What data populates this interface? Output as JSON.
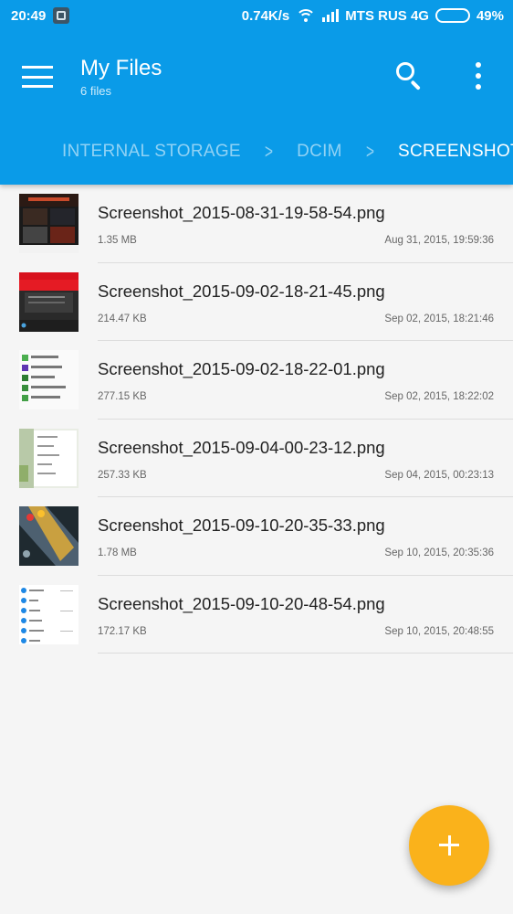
{
  "status_bar": {
    "time": "20:49",
    "speed": "0.74K/s",
    "carrier": "MTS RUS 4G",
    "battery": "49%",
    "battery_level": 0.49
  },
  "toolbar": {
    "title": "My Files",
    "subtitle": "6 files"
  },
  "breadcrumb": [
    "INTERNAL STORAGE",
    "DCIM",
    "SCREENSHOTS"
  ],
  "files": [
    {
      "name": "Screenshot_2015-08-31-19-58-54.png",
      "size": "1.35 MB",
      "date": "Aug 31, 2015, 19:59:36"
    },
    {
      "name": "Screenshot_2015-09-02-18-21-45.png",
      "size": "214.47 KB",
      "date": "Sep 02, 2015, 18:21:46"
    },
    {
      "name": "Screenshot_2015-09-02-18-22-01.png",
      "size": "277.15 KB",
      "date": "Sep 02, 2015, 18:22:02"
    },
    {
      "name": "Screenshot_2015-09-04-00-23-12.png",
      "size": "257.33 KB",
      "date": "Sep 04, 2015, 00:23:13"
    },
    {
      "name": "Screenshot_2015-09-10-20-35-33.png",
      "size": "1.78 MB",
      "date": "Sep 10, 2015, 20:35:36"
    },
    {
      "name": "Screenshot_2015-09-10-20-48-54.png",
      "size": "172.17 KB",
      "date": "Sep 10, 2015, 20:48:55"
    }
  ],
  "colors": {
    "app_bar": "#0a9be8",
    "fab": "#fab21b"
  },
  "icons": {
    "status_app": "gallery-app-icon",
    "menu": "hamburger-menu-icon",
    "search": "search-icon",
    "more": "more-vert-icon",
    "separator": "chevron-right-icon",
    "fab": "plus-icon"
  }
}
